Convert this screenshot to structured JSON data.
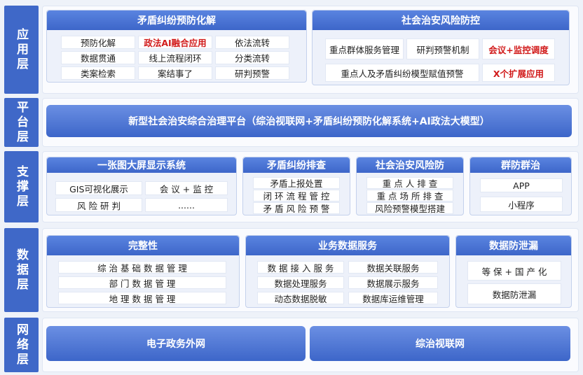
{
  "layers": {
    "application": "应用层",
    "platform": "平台层",
    "support": "支撑层",
    "data": "数据层",
    "network": "网络层"
  },
  "application": {
    "dispute": {
      "title": "矛盾纠纷预防化解",
      "cells": [
        "预防化解",
        "政法AI融合应用",
        "依法流转",
        "数据贯通",
        "线上流程闭环",
        "分类流转",
        "类案检索",
        "案结事了",
        "研判预警"
      ]
    },
    "risk": {
      "title": "社会治安风险防控",
      "cells": [
        "重点群体服务管理",
        "研判预警机制",
        "会议+监控调度",
        "重点人及矛盾纠纷模型赋值预警",
        "X个扩展应用"
      ]
    }
  },
  "platform": {
    "title": "新型社会治安综合治理平台（综治视联网+矛盾纠纷预防化解系统+AI政法大模型）"
  },
  "support": {
    "screen": {
      "title": "一张图大屏显示系统",
      "cells": [
        "GIS可视化展示",
        "会 议 + 监 控",
        "风 险 研 判",
        "......"
      ]
    },
    "check": {
      "title": "矛盾纠纷排查",
      "cells": [
        "矛盾上报处置",
        "闭 环 流 程 管 控",
        "矛 盾 风 险 预 警"
      ]
    },
    "prevent": {
      "title": "社会治安风险防",
      "cells": [
        "重 点 人 排 查",
        "重 点 场 所 排 查",
        "风险预警模型搭建"
      ]
    },
    "mass": {
      "title": "群防群治",
      "cells": [
        "APP",
        "小程序"
      ]
    }
  },
  "data": {
    "integrity": {
      "title": "完整性",
      "cells": [
        "综 治 基 础 数 据 管 理",
        "部 门 数 据 管 理",
        "地 理 数 据 管 理"
      ]
    },
    "business": {
      "title": "业务数据服务",
      "cells": [
        "数 据 接 入 服 务",
        "数据关联服务",
        "数据处理服务",
        "数据展示服务",
        "动态数据脱敏",
        "数据库运维管理"
      ]
    },
    "leak": {
      "title": "数据防泄漏",
      "cells": [
        "等 保 + 国 产 化",
        "数据防泄漏"
      ]
    }
  },
  "network": {
    "left": "电子政务外网",
    "right": "综治视联网"
  },
  "colors": {
    "accent": "#3d66c9",
    "highlight_text": "#d11a1a"
  }
}
